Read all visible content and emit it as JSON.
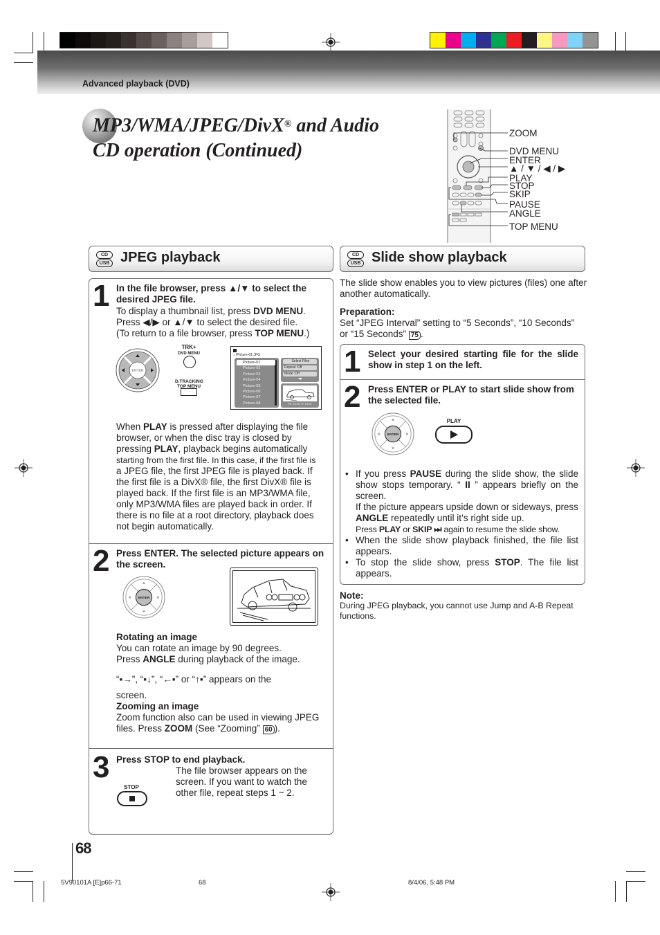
{
  "header": {
    "section_label": "Advanced playback (DVD)",
    "title_line1": "MP3/WMA/JPEG/DivX",
    "title_reg": "®",
    "title_line1_rest": " and Audio",
    "title_line2": "CD operation (Continued)",
    "grayscale_bars": [
      "#000000",
      "#0d0a09",
      "#1c1816",
      "#25201e",
      "#3a3230",
      "#544a47",
      "#6b615e",
      "#8b817e",
      "#a89f9c",
      "#d1c7c4",
      "#ffffff"
    ],
    "color_bars": [
      "#fff200",
      "#ec008c",
      "#00aeef",
      "#2e3192",
      "#00a651",
      "#ed1c24",
      "#231f20",
      "#fff684",
      "#f49ac1",
      "#7fd3f7",
      "#939393"
    ]
  },
  "remote_labels": [
    "ZOOM",
    "DVD MENU",
    "ENTER",
    "▲ / ▼ / ◀ / ▶",
    "PLAY",
    "STOP",
    "SKIP",
    "PAUSE",
    "ANGLE",
    "TOP MENU"
  ],
  "badges": {
    "cd": "CD",
    "usb": "USB"
  },
  "jpeg": {
    "heading": "JPEG playback",
    "step1": {
      "num": "1",
      "bold_line": "In the file browser, press ▲/▼ to select the desired JPEG file.",
      "line1_pre": "To display a thumbnail list, press ",
      "line1_bold": "DVD MENU",
      "line1_post": ".",
      "line2": "Press ◀/▶ or ▲/▼ to select the desired file.",
      "line3_pre": "(To return to a file browser, press ",
      "line3_bold": "TOP MENU",
      "line3_post": ".)",
      "pad_label": "ENTER",
      "btn1_label_a": "TRK+",
      "btn1_label_b": "DVD MENU",
      "btn2_label_a": "D.TRACKING",
      "btn2_label_b": "TOP MENU",
      "screen": {
        "path": "/Picture-01.JPG",
        "files": [
          "Picture-01",
          "Picture-02",
          "Picture-03",
          "Picture-04",
          "Picture-05",
          "Picture-06",
          "Picture-07",
          "Picture-08"
        ],
        "selected_index": 0,
        "panel_buttons": [
          "Select Files",
          "Repeat    :Off",
          "Mode      :Off"
        ],
        "resolution": "W: 2048  H: 1536"
      },
      "para": [
        {
          "t": "When "
        },
        {
          "b": "PLAY"
        },
        {
          "t": " is pressed after displaying the file browser, or when the disc tray is closed by pressing "
        },
        {
          "b": "PLAY"
        },
        {
          "t": ", playback begins automatically"
        }
      ],
      "para_small": "starting from the first file. In this case, if the first file is",
      "para_rest": "a JPEG file, the first JPEG file is played back. If the first file is a DivX® file, the first DivX® file is played back. If the first file is an MP3/WMA file, only MP3/WMA files are played back in order. If there is no file at a root directory, playback does not begin automatically."
    },
    "step2": {
      "num": "2",
      "bold_line": "Press ENTER. The selected picture appears on the screen.",
      "pad_label": "ENTER",
      "rot_title": "Rotating an image",
      "rot_line1": "You can rotate an image by 90 degrees.",
      "rot_line2_pre": "Press ",
      "rot_line2_bold": "ANGLE",
      "rot_line2_post": " during playback of the image.",
      "rot_icons_text": " appears on the",
      "rot_line4": "screen.",
      "zoom_title": "Zooming an image",
      "zoom_line1": "Zoom function also can be used in viewing JPEG",
      "zoom_line2_pre": "files. Press ",
      "zoom_line2_bold": "ZOOM",
      "zoom_line2_post": " (See “Zooming” ",
      "zoom_ref": "60",
      "zoom_line2_end": ")."
    },
    "step3": {
      "num": "3",
      "bold_line": "Press STOP to end playback.",
      "text": "The file browser appears on the screen. If you want to watch the other file, repeat steps 1 ~ 2.",
      "stop_label": "STOP"
    }
  },
  "slideshow": {
    "heading": "Slide show playback",
    "intro": "The slide show enables you to view pictures (files) one after another automatically.",
    "prep_title": "Preparation:",
    "prep_text": "Set “JPEG Interval” setting to “5 Seconds”, “10 Seconds” or “15 Seconds” ",
    "prep_ref": "75",
    "prep_end": ".",
    "step1": {
      "num": "1",
      "text": "Select your desired starting file for the slide show in step 1 on the left."
    },
    "step2": {
      "num": "2",
      "text": "Press ENTER or PLAY to start slide show from the selected file.",
      "pad_label": "ENTER",
      "play_label": "PLAY"
    },
    "bullets": {
      "b1_pre": "If you press ",
      "b1_bold": "PAUSE",
      "b1_post": " during the slide show, the slide show stops temporary. “ ",
      "b1_glyph": "II",
      "b1_end": " ” appears briefly on the screen.",
      "b1_p2_pre": "If the picture appears upside down or sideways, press ",
      "b1_p2_bold": "ANGLE",
      "b1_p2_post": " repeatedly until it’s right side up.",
      "b1_p3_pre": "Press ",
      "b1_p3_b1": "PLAY",
      "b1_p3_mid": " or ",
      "b1_p3_b2": "SKIP ⏭",
      "b1_p3_post": " again to resume the slide show.",
      "b2": "When the slide show playback finished, the file list appears.",
      "b3_pre": "To stop the slide show, press ",
      "b3_bold": "STOP",
      "b3_post": ". The file list appears."
    },
    "note_title": "Note:",
    "note_text": "During JPEG playback, you cannot use Jump and A-B Repeat functions."
  },
  "footer": {
    "page_number": "68",
    "doc_code": "5V90101A [E]p66-71",
    "print_page": "68",
    "timestamp": "8/4/06, 5:48 PM"
  }
}
